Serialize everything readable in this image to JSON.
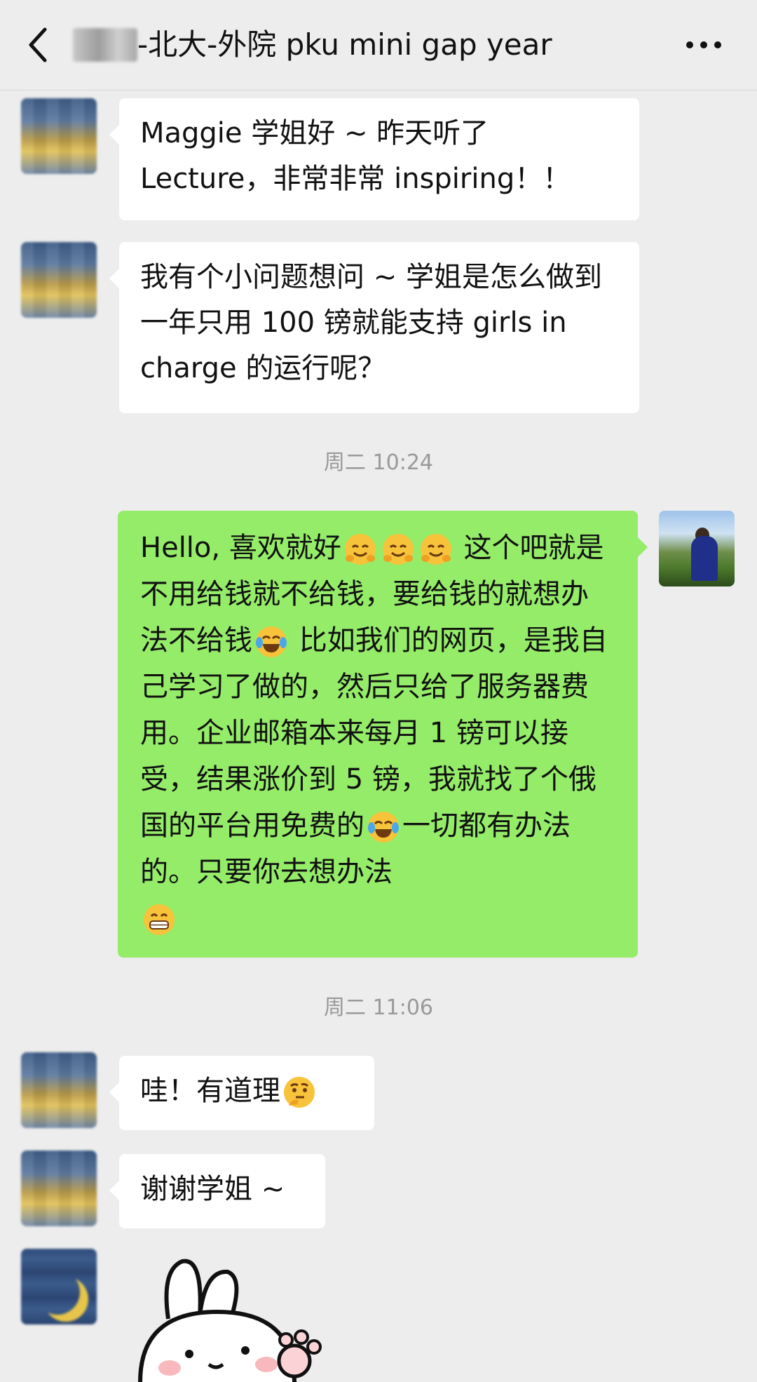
{
  "header": {
    "title": "-北大-外院 pku mini gap year"
  },
  "messages": [
    {
      "sender": "other",
      "text": "Maggie 学姐好 ~ 昨天听了 Lecture，非常非常 inspiring！！"
    },
    {
      "sender": "other",
      "text": "我有个小问题想问 ~ 学姐是怎么做到一年只用 100 镑就能支持 girls in charge 的运行呢？"
    },
    {
      "type": "timestamp",
      "text": "周二 10:24"
    },
    {
      "sender": "me",
      "part1": "Hello, 喜欢就好",
      "part2": " 这个吧就是不用给钱就不给钱，要给钱的就想办法不给钱",
      "part3": " 比如我们的网页，是我自己学习了做的，然后只给了服务器费用。企业邮箱本来每月 1 镑可以接受，结果涨价到 5 镑，我就找了个俄国的平台用免费的",
      "part4": "一切都有办法的。只要你去想办法"
    },
    {
      "type": "timestamp",
      "text": "周二 11:06"
    },
    {
      "sender": "other",
      "text": "哇！有道理"
    },
    {
      "sender": "other",
      "text": "谢谢学姐 ~"
    }
  ],
  "icons": {
    "back": "chevron-left-icon",
    "more": "more-dots-icon",
    "emoji_hug": "hugging-face-emoji",
    "emoji_laugh": "tears-of-joy-emoji",
    "emoji_think": "thinking-face-emoji",
    "emoji_grin": "grinning-face-emoji"
  },
  "colors": {
    "background": "#ededed",
    "bubble_other": "#ffffff",
    "bubble_me": "#95ec69",
    "timestamp": "#999999"
  }
}
